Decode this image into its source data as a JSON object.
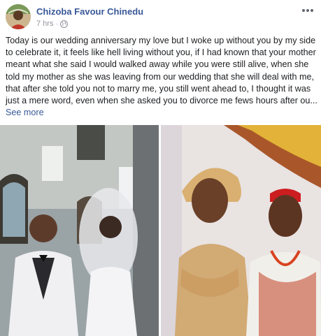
{
  "post": {
    "author": "Chizoba Favour Chinedu",
    "time": "7 hrs",
    "separator": "·",
    "privacy_icon": "globe-icon",
    "more_icon": "more-options-icon",
    "text": "Today is our wedding anniversary my love but I woke up without you by my side to celebrate it, it feels like hell living without you, if I had known that your mother meant what she said I would walked away while you were still alive, when she told my mother as she was leaving from our wedding that she will deal with me, that after she told you not to marry me, you still went ahead to, I thought it was just a mere word, even when she asked you to divorce me fews hours after ou...",
    "see_more": "See more"
  },
  "colors": {
    "author_link": "#385898",
    "meta_gray": "#90949c"
  }
}
